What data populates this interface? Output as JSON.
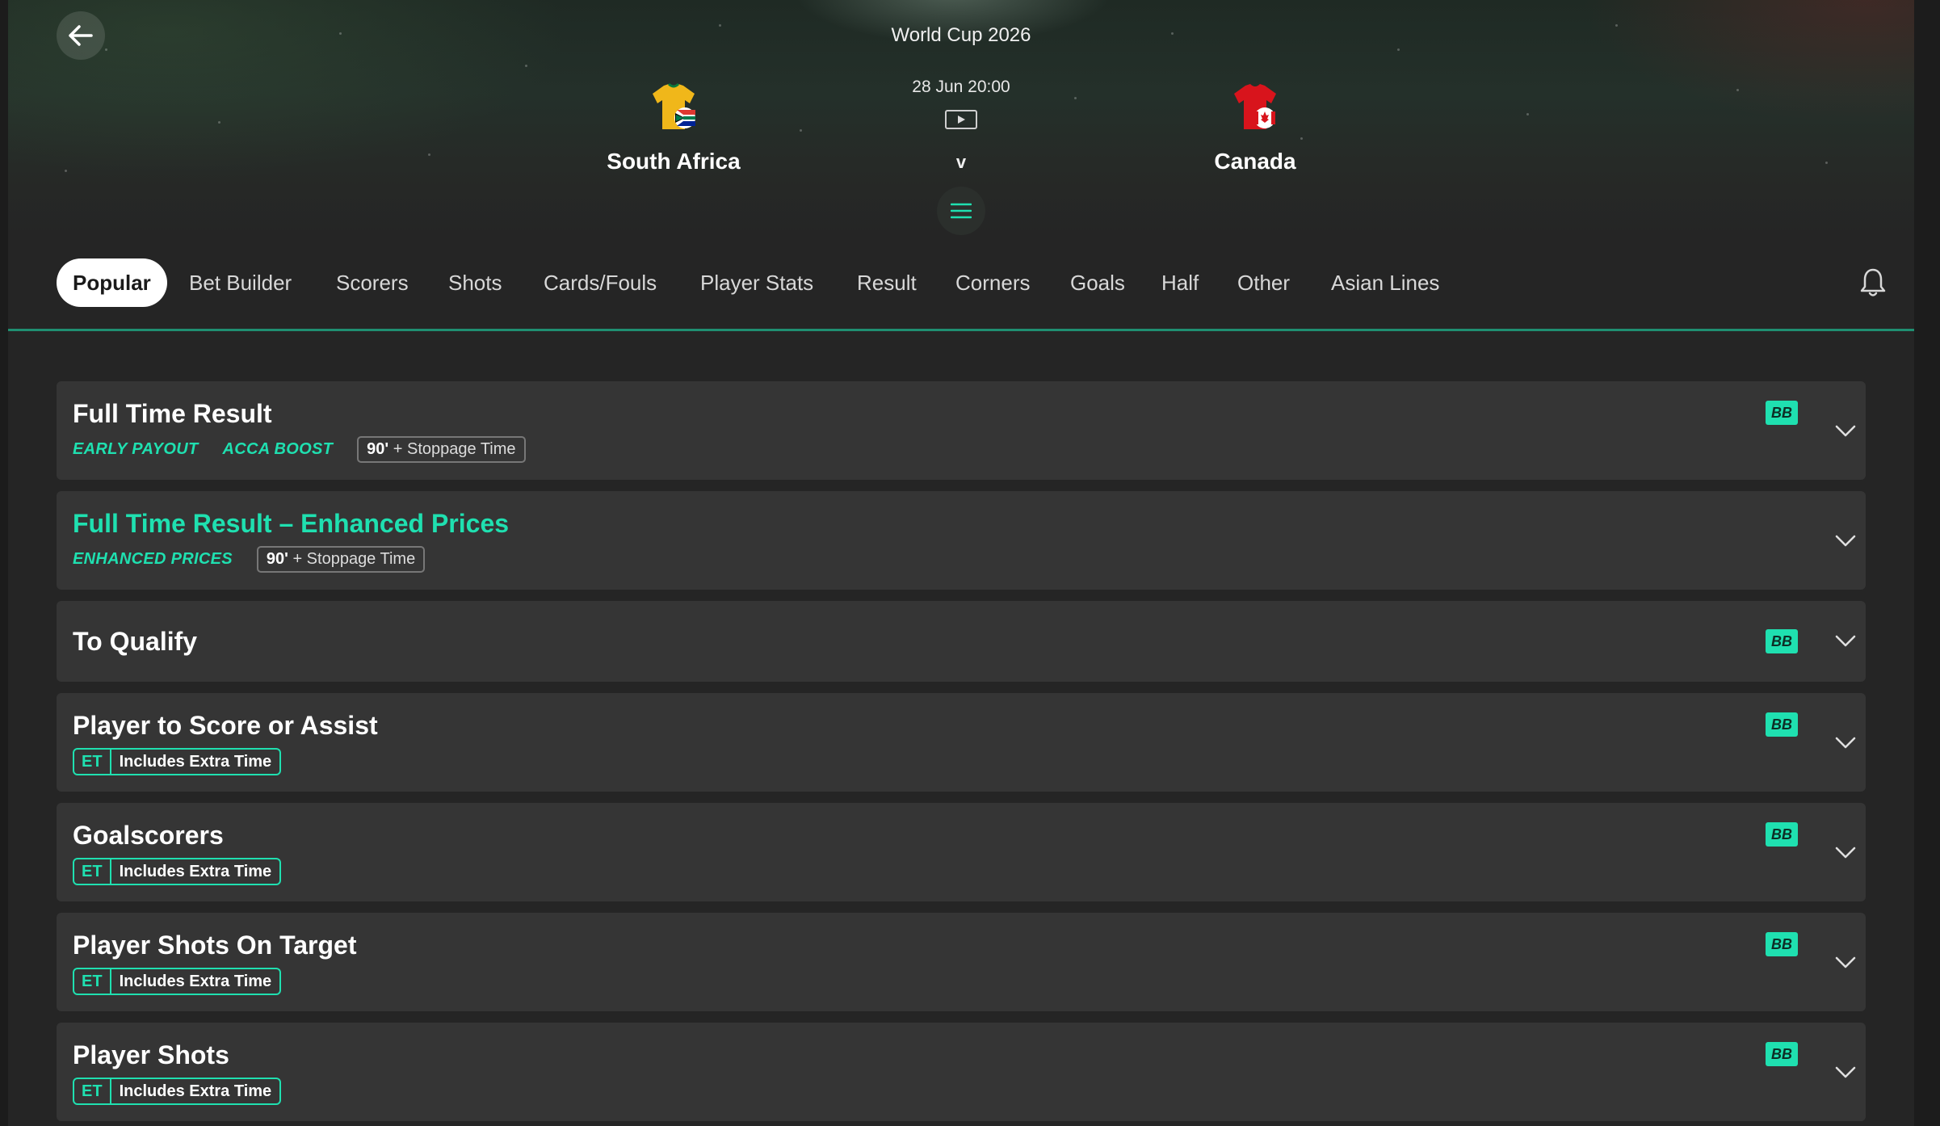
{
  "header": {
    "back_icon": "arrow-left-icon",
    "competition": "World Cup 2026",
    "kickoff": "28 Jun 20:00",
    "stream_icon": "play-stream-icon",
    "versus": "v",
    "home_team": {
      "name": "South Africa",
      "kit_colors": [
        "#f0b71a",
        "#0a7a3c"
      ]
    },
    "away_team": {
      "name": "Canada",
      "kit_colors": [
        "#d8141c",
        "#ffffff"
      ]
    },
    "menu_icon": "hamburger-menu-icon"
  },
  "tabs": [
    {
      "label": "Popular",
      "active": true
    },
    {
      "label": "Bet Builder"
    },
    {
      "label": "Scorers"
    },
    {
      "label": "Shots"
    },
    {
      "label": "Cards/Fouls"
    },
    {
      "label": "Player Stats"
    },
    {
      "label": "Result"
    },
    {
      "label": "Corners"
    },
    {
      "label": "Goals"
    },
    {
      "label": "Half"
    },
    {
      "label": "Other"
    },
    {
      "label": "Asian Lines"
    }
  ],
  "notification_icon": "bell-icon",
  "markets": [
    {
      "title": "Full Time Result",
      "promos": [
        "EARLY PAYOUT",
        "ACCA BOOST"
      ],
      "time_chip": {
        "bold": "90'",
        "text": "+ Stoppage Time"
      },
      "bb": "BB"
    },
    {
      "title": "Full Time Result – Enhanced Prices",
      "promos": [
        "ENHANCED PRICES"
      ],
      "time_chip": {
        "bold": "90'",
        "text": "+ Stoppage Time"
      }
    },
    {
      "title": "To Qualify",
      "bb": "BB"
    },
    {
      "title": "Player to Score or Assist",
      "et_chip": {
        "code": "ET",
        "label": "Includes Extra Time"
      },
      "bb": "BB"
    },
    {
      "title": "Goalscorers",
      "et_chip": {
        "code": "ET",
        "label": "Includes Extra Time"
      },
      "bb": "BB"
    },
    {
      "title": "Player Shots On Target",
      "et_chip": {
        "code": "ET",
        "label": "Includes Extra Time"
      },
      "bb": "BB"
    },
    {
      "title": "Player Shots",
      "et_chip": {
        "code": "ET",
        "label": "Includes Extra Time"
      },
      "bb": "BB"
    }
  ],
  "colors": {
    "accent": "#1fe0b0",
    "card": "#353535",
    "background": "#252525"
  }
}
